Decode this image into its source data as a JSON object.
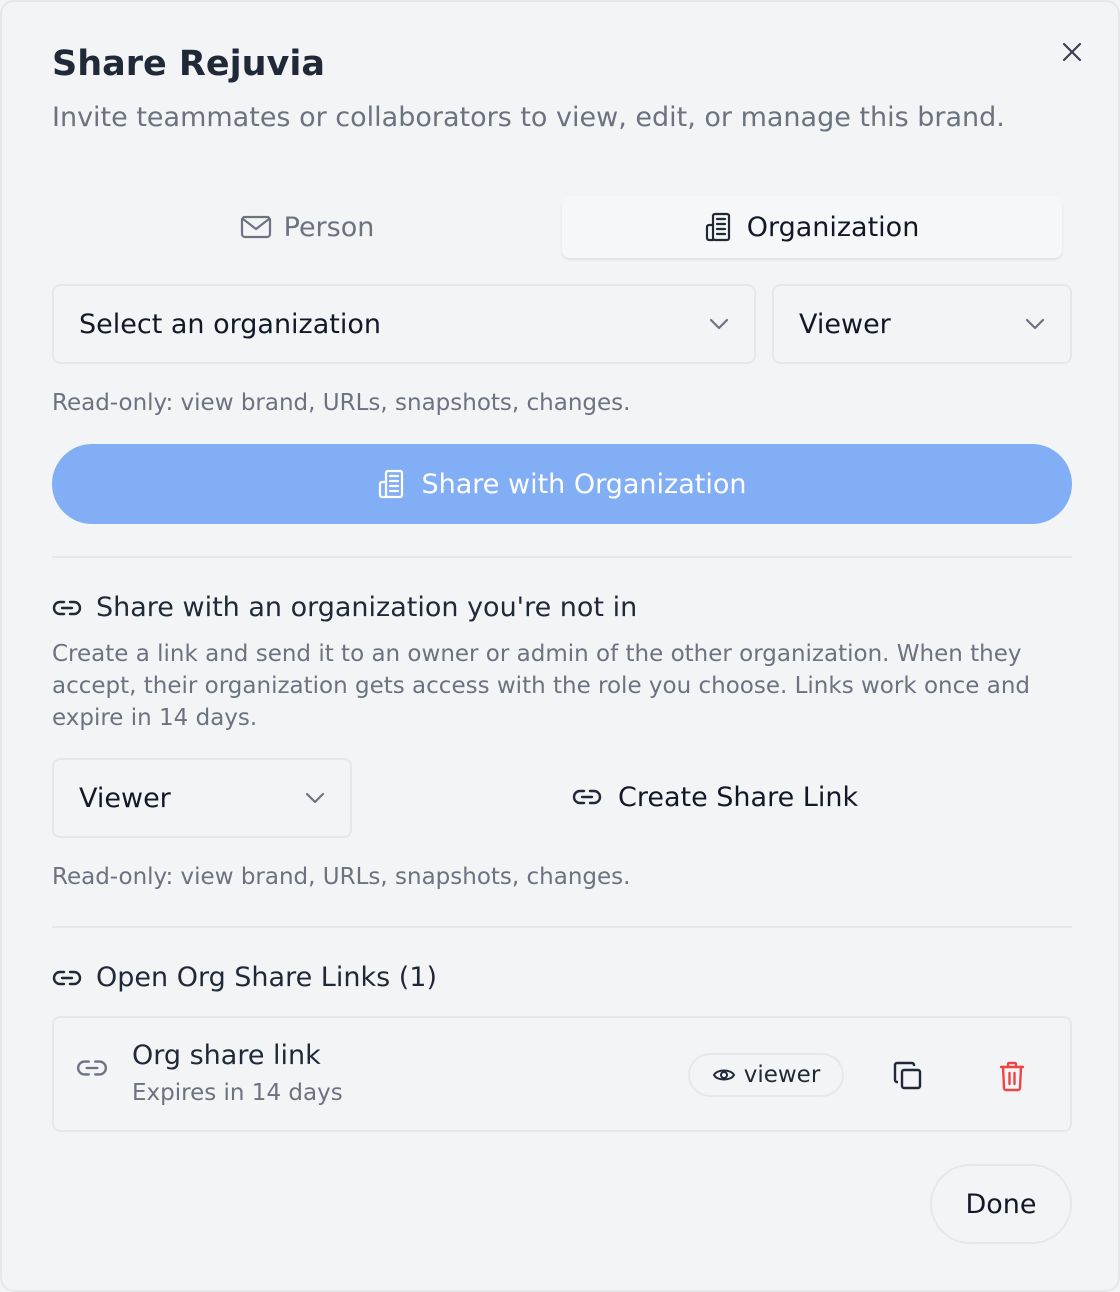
{
  "dialog": {
    "title": "Share Rejuvia",
    "subtitle": "Invite teammates or collaborators to view, edit, or manage this brand."
  },
  "tabs": [
    {
      "label": "Person",
      "icon": "mail-icon",
      "active": false
    },
    {
      "label": "Organization",
      "icon": "building-icon",
      "active": true
    }
  ],
  "org_share": {
    "org_select_value": "Select an organization",
    "role_select_value": "Viewer",
    "role_hint": "Read-only: view brand, URLs, snapshots, changes.",
    "share_button_label": "Share with Organization"
  },
  "external_share": {
    "heading": "Share with an organization you're not in",
    "description": "Create a link and send it to an owner or admin of the other organization. When they accept, their organization gets access with the role you choose. Links work once and expire in 14 days.",
    "role_select_value": "Viewer",
    "create_link_label": "Create Share Link",
    "role_hint": "Read-only: view brand, URLs, snapshots, changes."
  },
  "open_links": {
    "heading": "Open Org Share Links (1)",
    "items": [
      {
        "title": "Org share link",
        "expires": "Expires in 14 days",
        "role": "viewer"
      }
    ]
  },
  "footer": {
    "done_label": "Done"
  },
  "colors": {
    "primary_button": "#82aef5",
    "delete_icon": "#ef4444",
    "border": "#e5e7eb",
    "muted_text": "#6b7280"
  }
}
